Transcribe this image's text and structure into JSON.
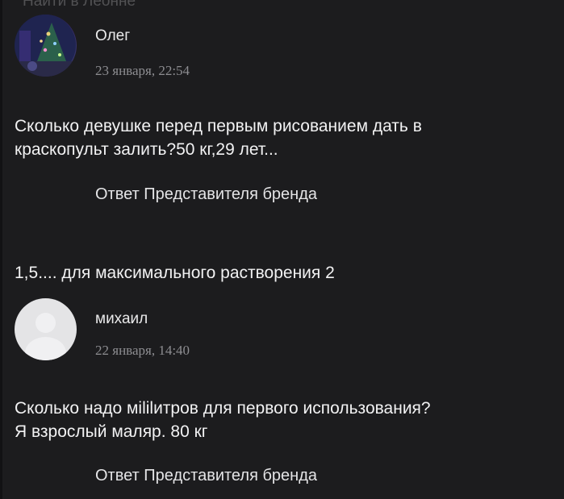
{
  "header": {
    "search_label": "Найти в Леонне"
  },
  "comments": [
    {
      "author": "Олег",
      "date": "23 января, 22:54",
      "question_lines": [
        "Сколько девушке перед первым рисованием дать в",
        "краскопульт залить?50 кг,29 лет..."
      ],
      "brand_reply_label": "Ответ Представителя бренда",
      "brand_reply_text": "1,5.... для максимального растворения 2"
    },
    {
      "author": "михаил",
      "date": "22 января, 14:40",
      "question_lines": [
        "Сколько надо мililитров для первого использования?",
        "Я взрослый маляр. 80 кг"
      ],
      "brand_reply_label": "Ответ Представителя бренда"
    }
  ]
}
